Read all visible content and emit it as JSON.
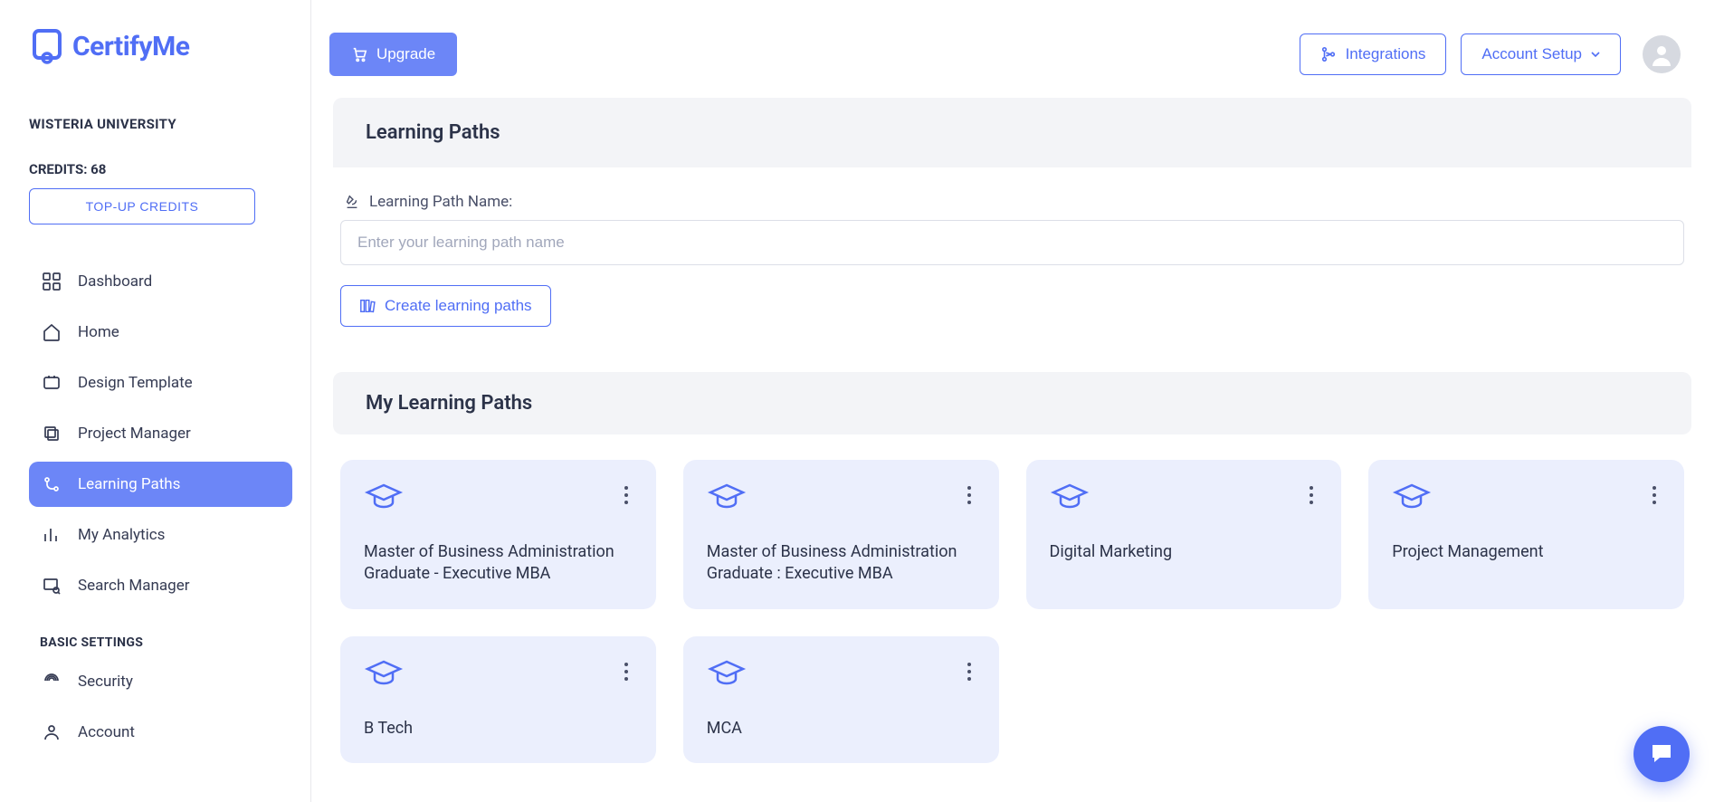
{
  "brand": {
    "name": "CertifyMe"
  },
  "sidebar": {
    "org_name": "WISTERIA UNIVERSITY",
    "credits_label": "CREDITS: 68",
    "topup_label": "TOP-UP CREDITS",
    "items": [
      {
        "label": "Dashboard"
      },
      {
        "label": "Home"
      },
      {
        "label": "Design Template"
      },
      {
        "label": "Project Manager"
      },
      {
        "label": "Learning Paths"
      },
      {
        "label": "My Analytics"
      },
      {
        "label": "Search Manager"
      }
    ],
    "basic_settings_heading": "BASIC SETTINGS",
    "settings": [
      {
        "label": "Security"
      },
      {
        "label": "Account"
      }
    ]
  },
  "topbar": {
    "upgrade_label": "Upgrade",
    "integrations_label": "Integrations",
    "account_setup_label": "Account Setup"
  },
  "panel": {
    "title": "Learning Paths",
    "field_label": "Learning Path Name:",
    "input_placeholder": "Enter your learning path name",
    "create_label": "Create learning paths"
  },
  "my_paths": {
    "title": "My Learning Paths",
    "cards": [
      {
        "title": "Master of Business Administration Graduate - Executive MBA"
      },
      {
        "title": "Master of Business Administration Graduate : Executive MBA"
      },
      {
        "title": "Digital Marketing"
      },
      {
        "title": "Project Management"
      },
      {
        "title": "B Tech"
      },
      {
        "title": "MCA"
      }
    ]
  },
  "colors": {
    "primary": "#506ef5",
    "primary_light": "#6c86f7",
    "card_bg": "#ebeffd"
  }
}
